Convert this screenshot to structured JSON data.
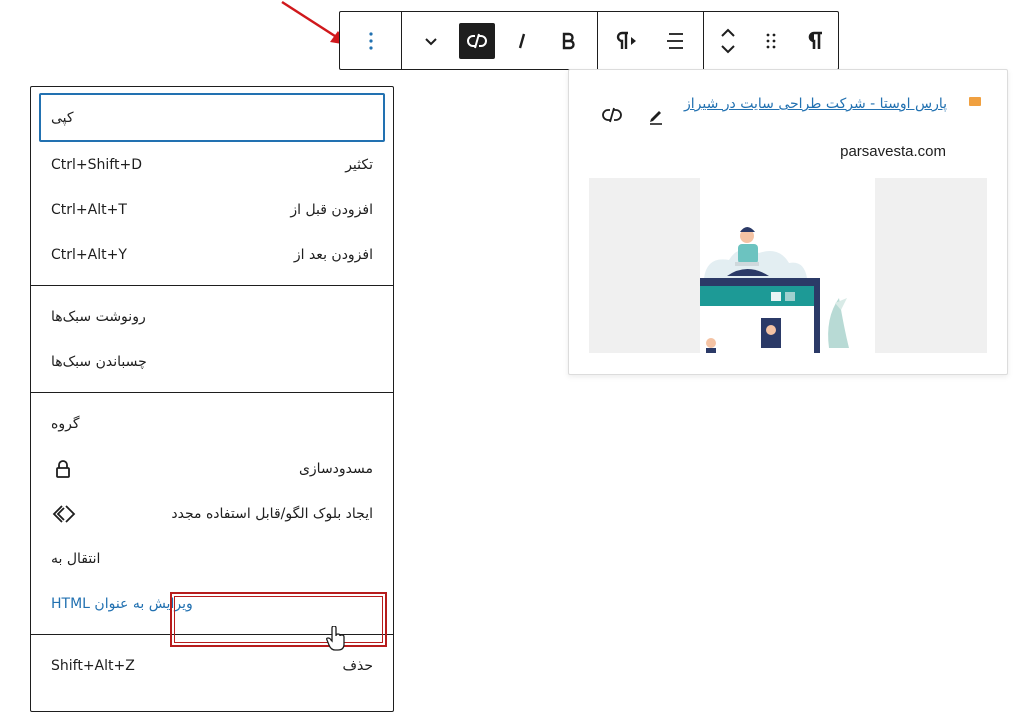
{
  "toolbar": {
    "buttons": [
      {
        "icon": "more-options-icon"
      },
      {
        "icon": "chevron-down-icon"
      },
      {
        "icon": "unlink-icon"
      },
      {
        "icon": "italic-icon",
        "text": "I"
      },
      {
        "icon": "bold-icon",
        "text": "B"
      },
      {
        "icon": "paragraph-rtl-icon"
      },
      {
        "icon": "align-icon"
      },
      {
        "icon": "move-up-down-icon"
      },
      {
        "icon": "drag-handle-icon"
      },
      {
        "icon": "paragraph-icon",
        "text": "¶"
      }
    ]
  },
  "link_preview": {
    "title": "پارس اوستا - شرکت طراحی سایت در شیراز",
    "domain": "parsavesta.com"
  },
  "menu": {
    "sections": [
      {
        "items": [
          {
            "label": "کپی",
            "shortcut": ""
          },
          {
            "label": "تکثیر",
            "shortcut": "Ctrl+Shift+D"
          },
          {
            "label": "افزودن قبل از",
            "shortcut": "Ctrl+Alt+T"
          },
          {
            "label": "افزودن بعد از",
            "shortcut": "Ctrl+Alt+Y"
          }
        ]
      },
      {
        "items": [
          {
            "label": "رونوشت سبک‌ها",
            "shortcut": ""
          },
          {
            "label": "چسباندن سبک‌ها",
            "shortcut": ""
          }
        ]
      },
      {
        "items": [
          {
            "label": "گروه",
            "shortcut": ""
          },
          {
            "label": "مسدودسازی",
            "icon": "lock-icon"
          },
          {
            "label": "ایجاد بلوک الگو/قابل استفاده مجدد",
            "icon": "reusable-block-icon"
          },
          {
            "label": "انتقال به",
            "shortcut": ""
          },
          {
            "label": "ویرایش به عنوان HTML",
            "shortcut": ""
          }
        ]
      },
      {
        "items": [
          {
            "label": "حذف",
            "shortcut": "Shift+Alt+Z"
          }
        ]
      }
    ]
  },
  "colors": {
    "accent": "#2271b1",
    "highlight_border": "#b71c1c",
    "arrow": "#d0181c"
  }
}
